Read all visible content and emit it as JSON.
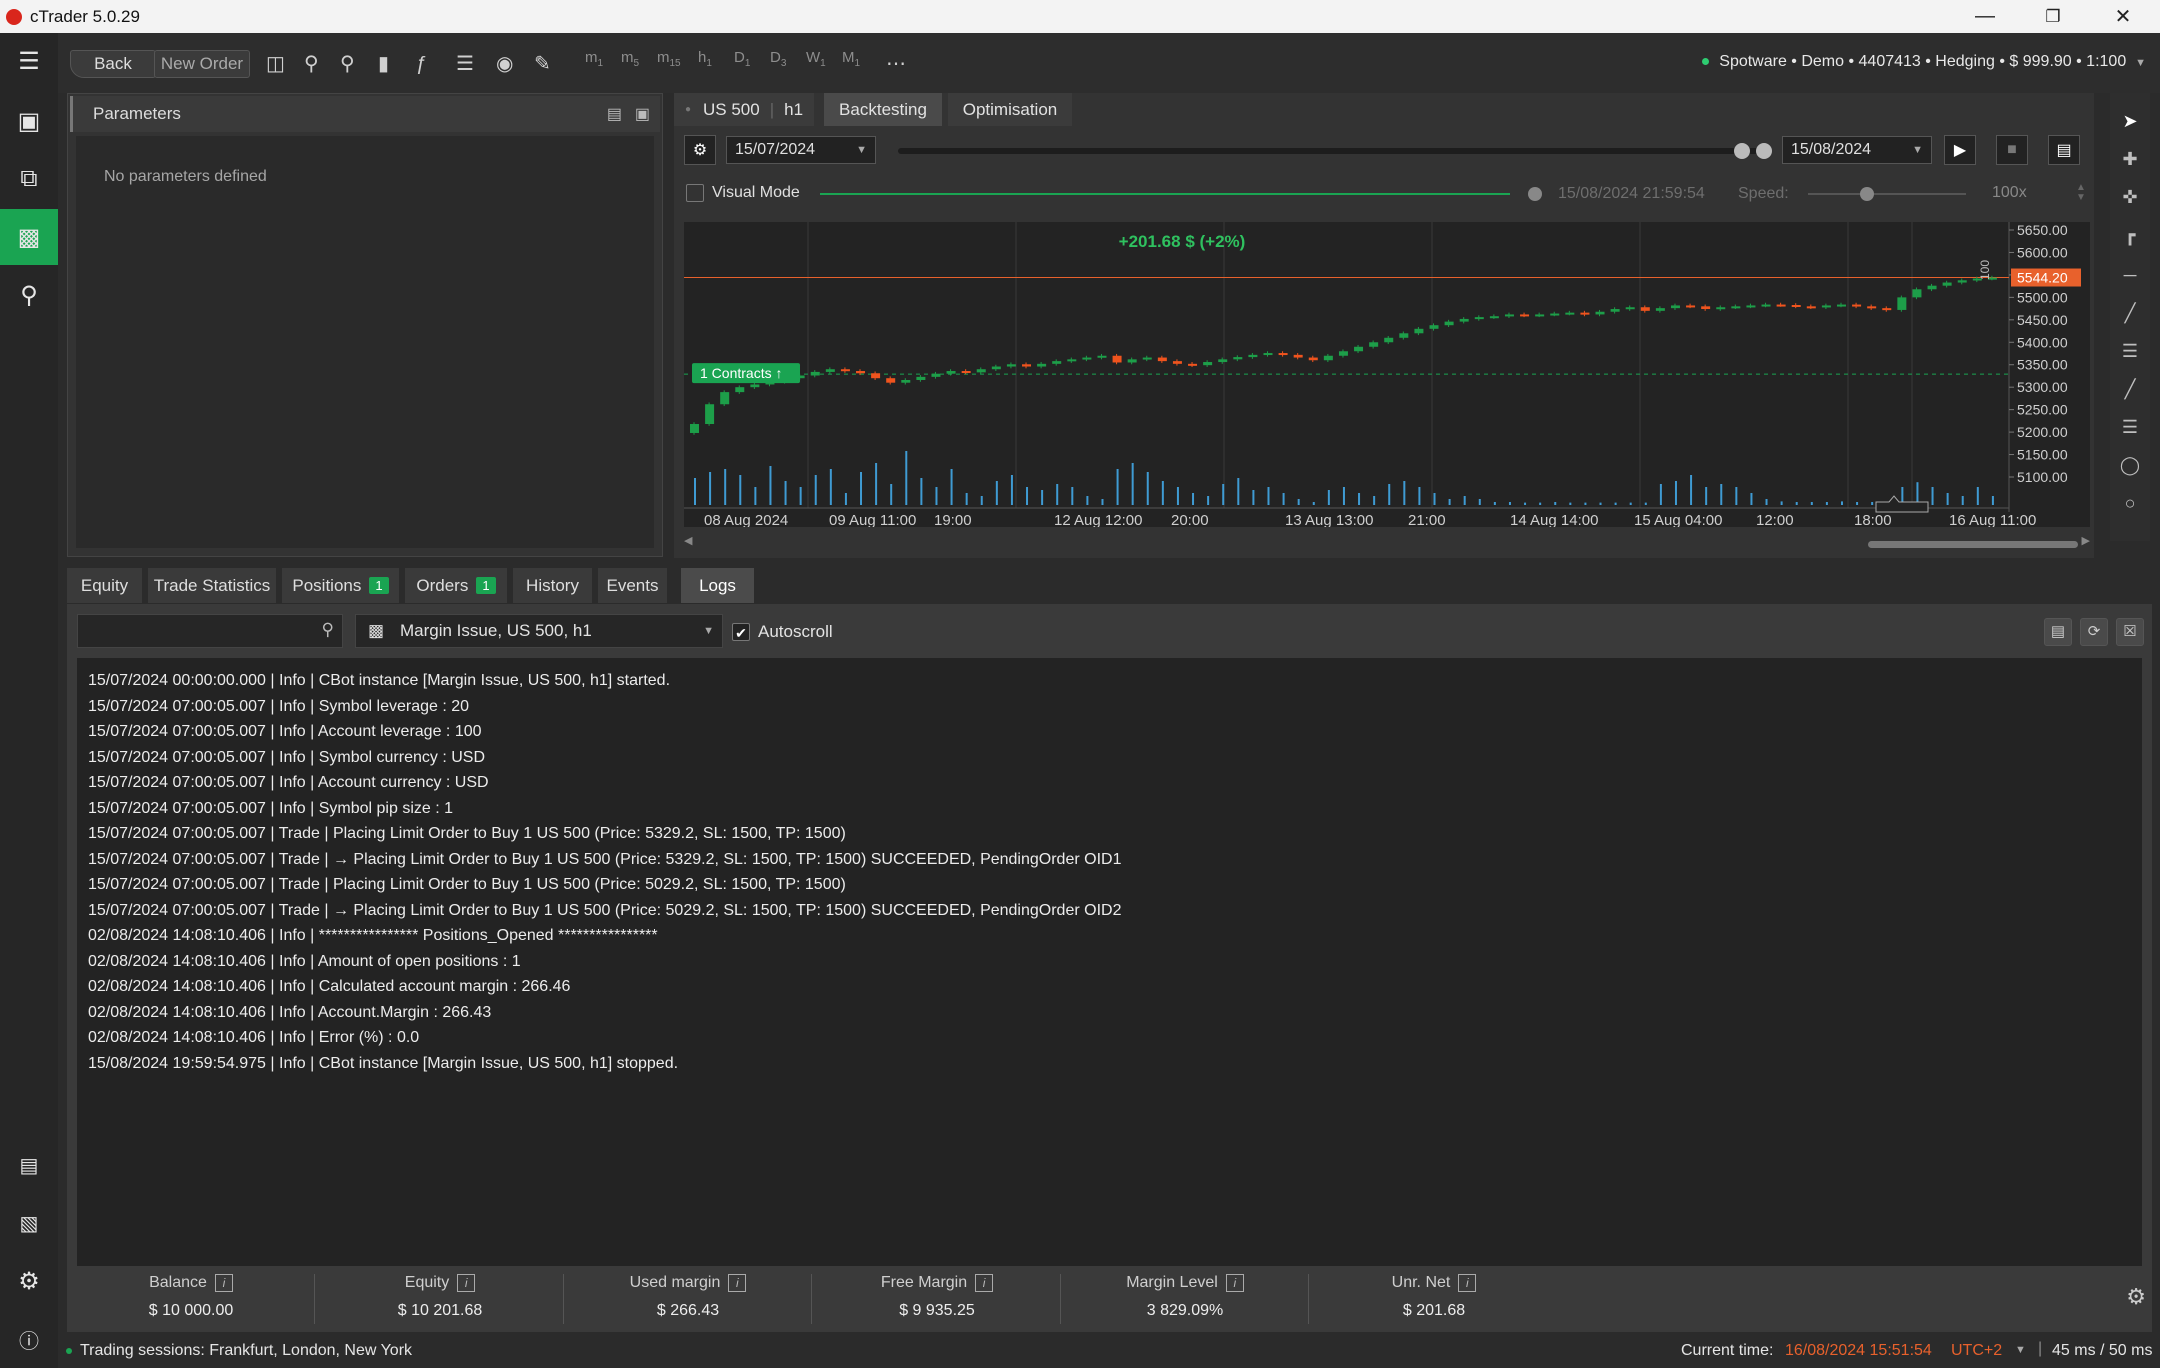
{
  "app": {
    "title": "cTrader 5.0.29"
  },
  "toolbar": {
    "back_label": "Back",
    "new_order_label": "New Order",
    "timeframes": [
      "m1",
      "m5",
      "m15",
      "h1",
      "D1",
      "D3",
      "W1",
      "M1"
    ],
    "account": "Spotware • Demo • 4407413 • Hedging • $ 999.90 • 1:100"
  },
  "params": {
    "title": "Parameters",
    "empty": "No parameters defined"
  },
  "backtest": {
    "symbol": "US 500",
    "timeframe": "h1",
    "tabs": [
      "Backtesting",
      "Optimisation"
    ],
    "start_date": "15/07/2024",
    "end_date": "15/08/2024",
    "visual_mode": "Visual Mode",
    "current_time": "15/08/2024 21:59:54",
    "speed_label": "Speed:",
    "speed_value": "100x"
  },
  "chart_data": {
    "type": "candlestick",
    "symbol": "US 500",
    "pnl_label": "+201.68 $ (+2%)",
    "position_label": "1 Contracts",
    "current_price": "5544.20",
    "volume_scale_label": "100",
    "x_ticks": [
      "08 Aug 2024",
      "09 Aug 11:00",
      "19:00",
      "12 Aug 12:00",
      "20:00",
      "13 Aug 13:00",
      "21:00",
      "14 Aug 14:00",
      "15 Aug 04:00",
      "12:00",
      "18:00",
      "16 Aug 11:00"
    ],
    "y_ticks": [
      "5650.00",
      "5600.00",
      "5550.00",
      "5500.00",
      "5450.00",
      "5400.00",
      "5350.00",
      "5300.00",
      "5250.00",
      "5200.00",
      "5150.00",
      "5100.00"
    ],
    "ylim": [
      5100,
      5650
    ],
    "position_entry_price": 5329.2,
    "close": [
      5218,
      5262,
      5289,
      5300,
      5306,
      5312,
      5320,
      5326,
      5334,
      5340,
      5336,
      5331,
      5320,
      5310,
      5316,
      5323,
      5330,
      5336,
      5333,
      5340,
      5346,
      5351,
      5346,
      5352,
      5358,
      5362,
      5366,
      5370,
      5355,
      5362,
      5366,
      5358,
      5352,
      5349,
      5356,
      5362,
      5367,
      5372,
      5376,
      5372,
      5366,
      5360,
      5370,
      5380,
      5390,
      5400,
      5410,
      5420,
      5430,
      5438,
      5446,
      5452,
      5456,
      5458,
      5462,
      5460,
      5462,
      5464,
      5466,
      5462,
      5468,
      5474,
      5478,
      5470,
      5476,
      5482,
      5480,
      5474,
      5478,
      5480,
      5482,
      5484,
      5483,
      5480,
      5478,
      5482,
      5484,
      5480,
      5476,
      5472,
      5500,
      5518,
      5526,
      5533,
      5538,
      5542,
      5544
    ],
    "volume_relative": [
      0.45,
      0.55,
      0.6,
      0.5,
      0.3,
      0.65,
      0.4,
      0.3,
      0.5,
      0.6,
      0.2,
      0.55,
      0.7,
      0.35,
      0.9,
      0.45,
      0.3,
      0.6,
      0.2,
      0.15,
      0.4,
      0.5,
      0.3,
      0.25,
      0.35,
      0.3,
      0.15,
      0.1,
      0.6,
      0.7,
      0.55,
      0.4,
      0.3,
      0.2,
      0.15,
      0.35,
      0.45,
      0.25,
      0.3,
      0.2,
      0.1,
      0.05,
      0.25,
      0.3,
      0.2,
      0.15,
      0.35,
      0.4,
      0.3,
      0.2,
      0.1,
      0.15,
      0.1,
      0.05,
      0.05,
      0.04,
      0.04,
      0.05,
      0.04,
      0.04,
      0.04,
      0.04,
      0.04,
      0.04,
      0.35,
      0.4,
      0.5,
      0.3,
      0.35,
      0.3,
      0.2,
      0.1,
      0.06,
      0.05,
      0.05,
      0.05,
      0.06,
      0.05,
      0.05,
      0.05,
      0.3,
      0.38,
      0.3,
      0.2,
      0.15,
      0.3,
      0.15
    ]
  },
  "bottom_tabs": [
    {
      "label": "Equity"
    },
    {
      "label": "Trade Statistics"
    },
    {
      "label": "Positions",
      "badge": "1"
    },
    {
      "label": "Orders",
      "badge": "1"
    },
    {
      "label": "History"
    },
    {
      "label": "Events"
    },
    {
      "label": "Logs",
      "active": true
    }
  ],
  "logs": {
    "bot_select": "Margin Issue, US 500, h1",
    "autoscroll": "Autoscroll",
    "lines": [
      "15/07/2024 00:00:00.000 | Info | CBot instance [Margin Issue, US 500, h1] started.",
      "15/07/2024 07:00:05.007 | Info | Symbol leverage : 20",
      "15/07/2024 07:00:05.007 | Info | Account leverage : 100",
      "15/07/2024 07:00:05.007 | Info | Symbol currency : USD",
      "15/07/2024 07:00:05.007 | Info | Account currency : USD",
      "15/07/2024 07:00:05.007 | Info | Symbol pip size : 1",
      "15/07/2024 07:00:05.007 | Trade | Placing Limit Order to Buy 1 US 500 (Price: 5329.2, SL: 1500, TP: 1500)",
      "15/07/2024 07:00:05.007 | Trade | → Placing Limit Order to Buy 1 US 500 (Price: 5329.2, SL: 1500, TP: 1500) SUCCEEDED, PendingOrder OID1",
      "15/07/2024 07:00:05.007 | Trade | Placing Limit Order to Buy 1 US 500 (Price: 5029.2, SL: 1500, TP: 1500)",
      "15/07/2024 07:00:05.007 | Trade | → Placing Limit Order to Buy 1 US 500 (Price: 5029.2, SL: 1500, TP: 1500) SUCCEEDED, PendingOrder OID2",
      "02/08/2024 14:08:10.406 | Info | **************** Positions_Opened ****************",
      "02/08/2024 14:08:10.406 | Info | Amount of open positions : 1",
      "02/08/2024 14:08:10.406 | Info | Calculated account margin : 266.46",
      "02/08/2024 14:08:10.406 | Info | Account.Margin : 266.43",
      "02/08/2024 14:08:10.406 | Info | Error (%) : 0.0",
      "15/08/2024 19:59:54.975 | Info | CBot instance [Margin Issue, US 500, h1] stopped."
    ]
  },
  "stats": [
    {
      "label": "Balance",
      "value": "$ 10 000.00"
    },
    {
      "label": "Equity",
      "value": "$ 10 201.68"
    },
    {
      "label": "Used margin",
      "value": "$ 266.43"
    },
    {
      "label": "Free Margin",
      "value": "$ 9 935.25"
    },
    {
      "label": "Margin Level",
      "value": "3 829.09%"
    },
    {
      "label": "Unr. Net",
      "value": "$ 201.68"
    }
  ],
  "status": {
    "sessions": "Trading sessions: Frankfurt, London, New York",
    "current_time_label": "Current time:",
    "current_time": "16/08/2024 15:51:54",
    "tz": "UTC+2",
    "latency": "45 ms / 50 ms"
  },
  "colors": {
    "accent": "#1aa452",
    "bull": "#1d9e49",
    "bear": "#f0541e",
    "price_line": "#e8612c"
  }
}
